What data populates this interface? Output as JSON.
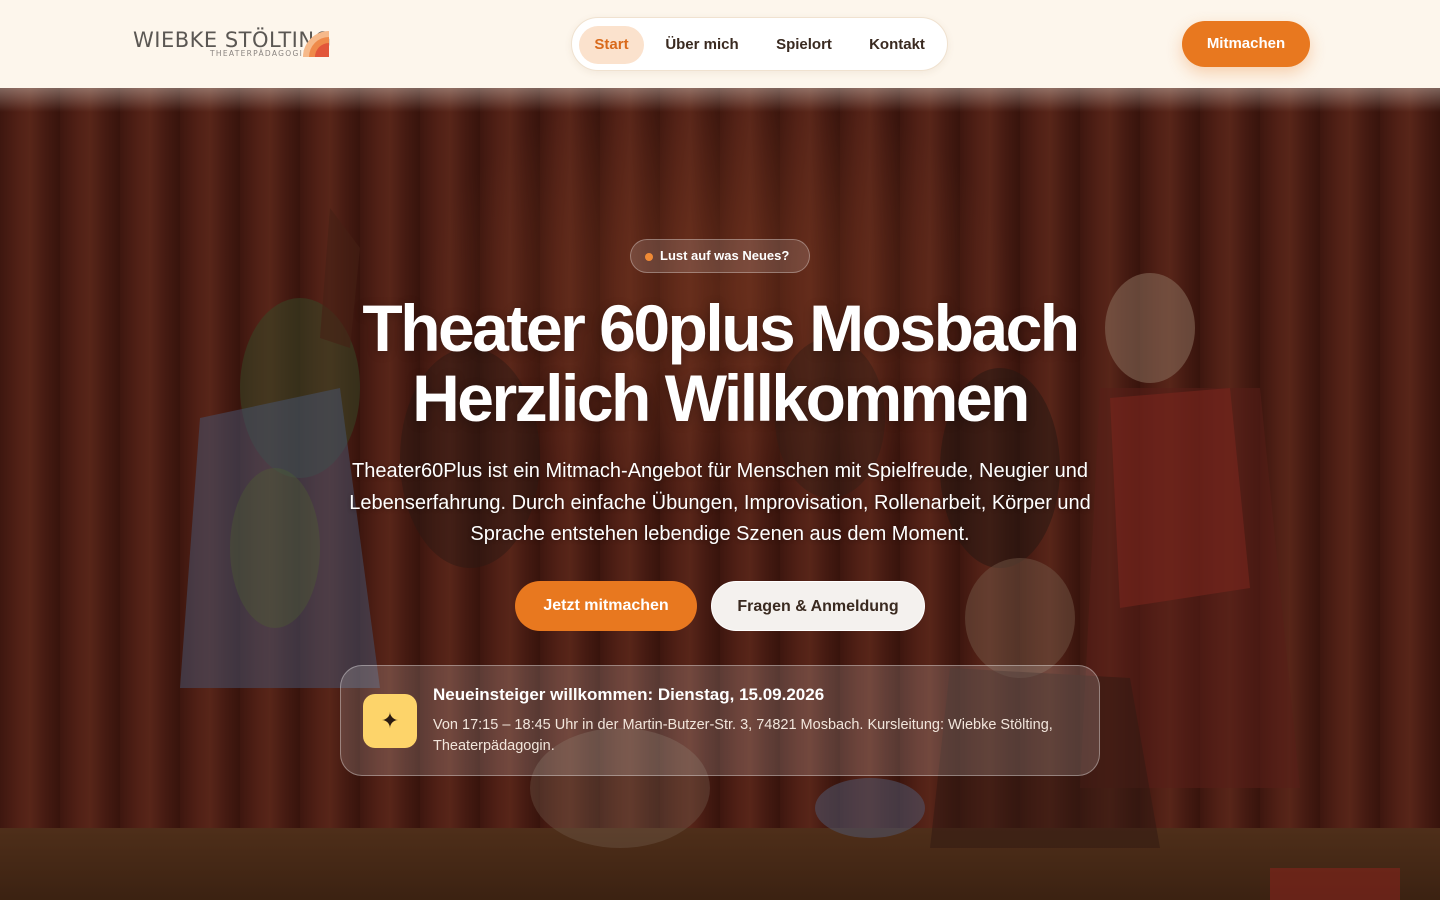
{
  "header": {
    "logo_name": "WIEBKE STÖLTING",
    "logo_sub": "THEATERPÄDAGOGIK",
    "nav": [
      {
        "label": "Start",
        "active": true
      },
      {
        "label": "Über mich",
        "active": false
      },
      {
        "label": "Spielort",
        "active": false
      },
      {
        "label": "Kontakt",
        "active": false
      }
    ],
    "cta_label": "Mitmachen"
  },
  "hero": {
    "badge": "Lust auf was Neues?",
    "title_line1": "Theater 60plus Mosbach",
    "title_line2": "Herzlich Willkommen",
    "lead": "Theater60Plus ist ein Mitmach-Angebot für Menschen mit Spielfreude, Neugier und Lebenserfahrung. Durch einfache Übungen, Improvisation, Rollenarbeit, Körper und Sprache entstehen lebendige Szenen aus dem Moment.",
    "primary_button": "Jetzt mitmachen",
    "secondary_button": "Fragen & Anmeldung",
    "info_title": "Neueinsteiger willkommen: Dienstag, 15.09.2026",
    "info_text": "Von 17:15 – 18:45 Uhr in der Martin-Butzer-Str. 3, 74821 Mosbach. Kursleitung: Wiebke Stölting, Theaterpädagogin.",
    "info_icon": "sparkle-icon"
  },
  "colors": {
    "accent": "#e8781f",
    "header_bg": "#fdf6ec",
    "active_nav_bg": "#fbe2cd",
    "info_icon_bg": "#fdd46a"
  }
}
